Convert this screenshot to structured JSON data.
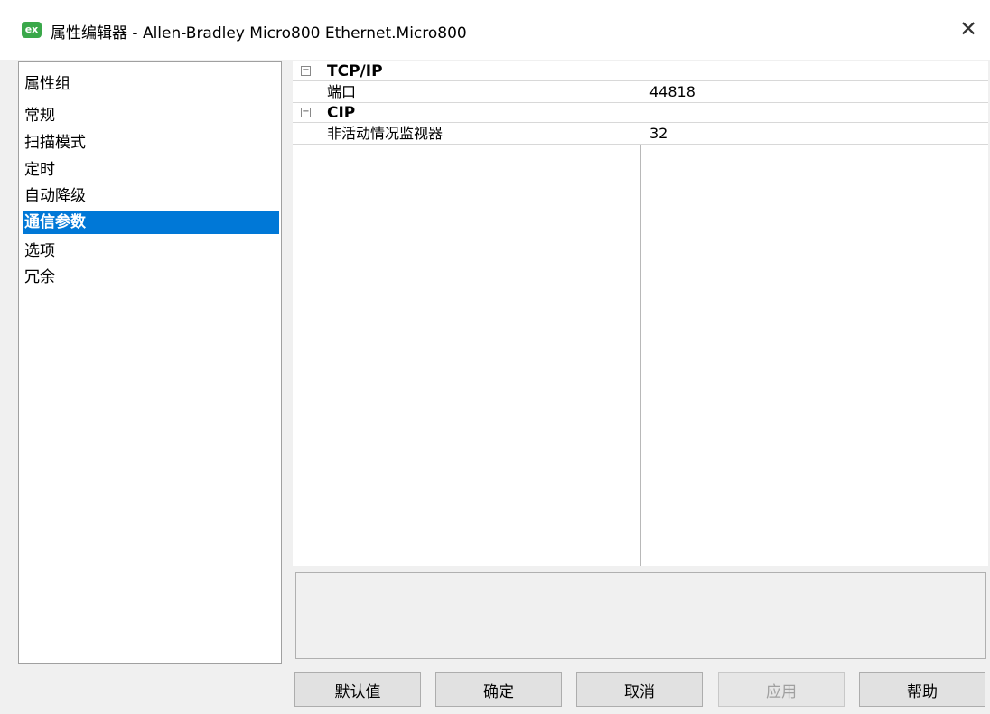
{
  "window": {
    "title": "属性编辑器 - Allen-Bradley Micro800 Ethernet.Micro800",
    "app_icon_label": "ex",
    "close_glyph": "✕"
  },
  "sidebar": {
    "items": [
      {
        "label": "属性组"
      },
      {
        "label": "常规"
      },
      {
        "label": "扫描模式"
      },
      {
        "label": "定时"
      },
      {
        "label": "自动降级"
      },
      {
        "label": "通信参数"
      },
      {
        "label": "选项"
      },
      {
        "label": "冗余"
      }
    ],
    "selected_index": 5
  },
  "grid": {
    "categories": [
      {
        "toggle": "⊟",
        "name": "TCP/IP",
        "rows": [
          {
            "name": "端口",
            "value": "44818"
          }
        ]
      },
      {
        "toggle": "⊟",
        "name": "CIP",
        "rows": [
          {
            "name": "非活动情况监视器",
            "value": "32"
          }
        ]
      }
    ]
  },
  "buttons": {
    "defaults": "默认值",
    "ok": "确定",
    "cancel": "取消",
    "apply": "应用",
    "help": "帮助"
  },
  "colors": {
    "selection": "#0078d7",
    "disabled_text": "#a0a0a0"
  }
}
